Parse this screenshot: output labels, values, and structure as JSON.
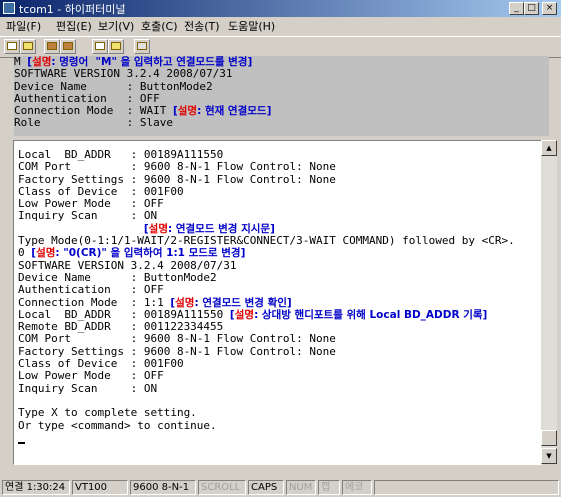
{
  "window": {
    "title": "tcom1 - 하이퍼터미널",
    "controls": [
      "_",
      "□",
      "×"
    ]
  },
  "menu": [
    "파일(F)",
    "편집(E)",
    "보기(V)",
    "호출(C)",
    "전송(T)",
    "도움말(H)"
  ],
  "upper_lines": [
    [
      {
        "t": "M "
      },
      {
        "t": "[",
        "c": "blue"
      },
      {
        "t": "설명",
        "c": "red"
      },
      {
        "t": ": 명령어  \"M\" 을 입력하고 연결모드를 변경]",
        "c": "blue"
      }
    ],
    [
      {
        "t": "SOFTWARE VERSION 3.2.4 2008/07/31"
      }
    ],
    [
      {
        "t": "Device Name      : ButtonMode2"
      }
    ],
    [
      {
        "t": "Authentication   : OFF"
      }
    ],
    [
      {
        "t": "Connection Mode  : WAIT "
      },
      {
        "t": "[",
        "c": "blue"
      },
      {
        "t": "설명",
        "c": "red"
      },
      {
        "t": ": 현재 연결모드]",
        "c": "blue"
      }
    ],
    [
      {
        "t": "Role             : Slave"
      }
    ]
  ],
  "terminal_lines": [
    [
      {
        "t": "Local  BD_ADDR   : 00189A111550"
      }
    ],
    [
      {
        "t": "COM Port         : 9600 8-N-1 Flow Control: None"
      }
    ],
    [
      {
        "t": "Factory Settings : 9600 8-N-1 Flow Control: None"
      }
    ],
    [
      {
        "t": "Class of Device  : 001F00"
      }
    ],
    [
      {
        "t": "Low Power Mode   : OFF"
      }
    ],
    [
      {
        "t": "Inquiry Scan     : ON"
      }
    ],
    [
      {
        "t": "                   "
      },
      {
        "t": "[",
        "c": "blue"
      },
      {
        "t": "설명",
        "c": "red"
      },
      {
        "t": ": 연결모드 변경 지시문]",
        "c": "blue"
      }
    ],
    [
      {
        "t": "Type Mode(0-1:1/1-WAIT/2-REGISTER&CONNECT/3-WAIT COMMAND) followed by <CR>."
      }
    ],
    [
      {
        "t": "0 "
      },
      {
        "t": "[",
        "c": "blue"
      },
      {
        "t": "설명",
        "c": "red"
      },
      {
        "t": ": \"0(CR)\" 을 입력하여 1:1 모드로 변경]",
        "c": "blue"
      }
    ],
    [
      {
        "t": "SOFTWARE VERSION 3.2.4 2008/07/31"
      }
    ],
    [
      {
        "t": "Device Name      : ButtonMode2"
      }
    ],
    [
      {
        "t": "Authentication   : OFF"
      }
    ],
    [
      {
        "t": "Connection Mode  : 1:1 "
      },
      {
        "t": "[",
        "c": "blue"
      },
      {
        "t": "설명",
        "c": "red"
      },
      {
        "t": ": 연결모드 변경 확인]",
        "c": "blue"
      }
    ],
    [
      {
        "t": "Local  BD_ADDR   : 00189A111550 "
      },
      {
        "t": "[",
        "c": "blue"
      },
      {
        "t": "설명",
        "c": "red"
      },
      {
        "t": ": 상대방 핸디포트를 위해 Local BD_ADDR 기록]",
        "c": "blue"
      }
    ],
    [
      {
        "t": "Remote BD_ADDR   : 001122334455"
      }
    ],
    [
      {
        "t": "COM Port         : 9600 8-N-1 Flow Control: None"
      }
    ],
    [
      {
        "t": "Factory Settings : 9600 8-N-1 Flow Control: None"
      }
    ],
    [
      {
        "t": "Class of Device  : 001F00"
      }
    ],
    [
      {
        "t": "Low Power Mode   : OFF"
      }
    ],
    [
      {
        "t": "Inquiry Scan     : ON"
      }
    ],
    [
      {
        "t": ""
      }
    ],
    [
      {
        "t": "Type X to complete setting."
      }
    ],
    [
      {
        "t": "Or type <command> to continue."
      }
    ],
    [
      {
        "t": ""
      }
    ]
  ],
  "status": {
    "connected": "연결 1:30:24",
    "emulation": "VT100",
    "port_settings": "9600 8-N-1",
    "scroll": "SCROLL",
    "caps": "CAPS",
    "num": "NUM",
    "capture": "캡",
    "echo": "에코"
  }
}
